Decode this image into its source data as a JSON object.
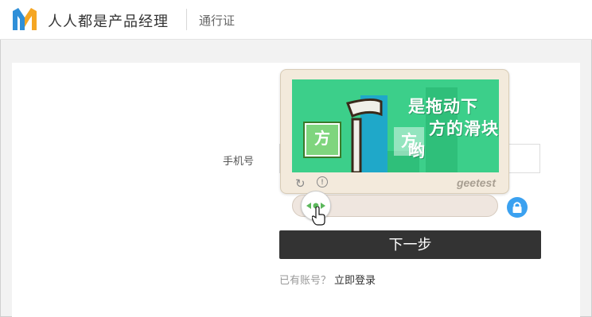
{
  "header": {
    "brand": "人人都是产品经理",
    "pass_label": "通行证",
    "logo_icon": "m-logo-icon"
  },
  "form": {
    "phone_label": "手机号",
    "phone_value": "",
    "next_label": "下一步",
    "have_account": "已有账号？",
    "login_link": "立即登录"
  },
  "captcha": {
    "hint": [
      "是拖动下",
      "方的滑块",
      "哟"
    ],
    "piece_char": "方",
    "hole_char": "方",
    "brand": "geetest",
    "refresh_icon": "refresh-icon",
    "info_icon": "info-icon",
    "slider_position": 0
  },
  "colors": {
    "captcha_bg": "#3ccf8a",
    "button_bg": "#333333",
    "lock_bg": "#3ba1f0"
  }
}
